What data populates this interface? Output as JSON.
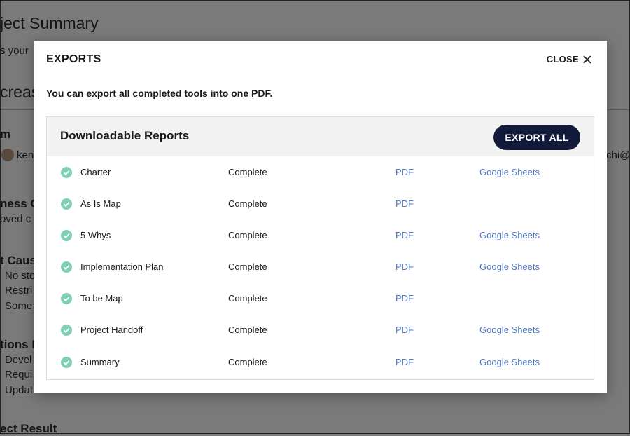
{
  "background": {
    "title": "ject Summary",
    "subtitle": "s your",
    "heading": "creas",
    "section_m": "m",
    "user_left": "ken",
    "user_right": "chi@",
    "section_business": "ness C",
    "business_text": "oved c",
    "section_cause": "t Caus",
    "cause_items": [
      "No sto",
      "Restri",
      "Some"
    ],
    "section_actions": "tions I",
    "action_items": [
      "Devel",
      "Requi",
      "Updat"
    ],
    "section_result": "ect Result"
  },
  "modal": {
    "title": "EXPORTS",
    "close_label": "CLOSE",
    "intro": "You can export all completed tools into one PDF.",
    "reports_title": "Downloadable Reports",
    "export_all_label": "EXPORT ALL",
    "check_color": "#7fcfb5",
    "link_color": "#4f79c4",
    "button_color": "#121a3a",
    "rows": [
      {
        "name": "Charter",
        "status": "Complete",
        "pdf": "PDF",
        "sheets": "Google Sheets"
      },
      {
        "name": "As Is Map",
        "status": "Complete",
        "pdf": "PDF",
        "sheets": ""
      },
      {
        "name": "5 Whys",
        "status": "Complete",
        "pdf": "PDF",
        "sheets": "Google Sheets"
      },
      {
        "name": "Implementation Plan",
        "status": "Complete",
        "pdf": "PDF",
        "sheets": "Google Sheets"
      },
      {
        "name": "To be Map",
        "status": "Complete",
        "pdf": "PDF",
        "sheets": ""
      },
      {
        "name": "Project Handoff",
        "status": "Complete",
        "pdf": "PDF",
        "sheets": "Google Sheets"
      },
      {
        "name": "Summary",
        "status": "Complete",
        "pdf": "PDF",
        "sheets": "Google Sheets"
      }
    ]
  }
}
